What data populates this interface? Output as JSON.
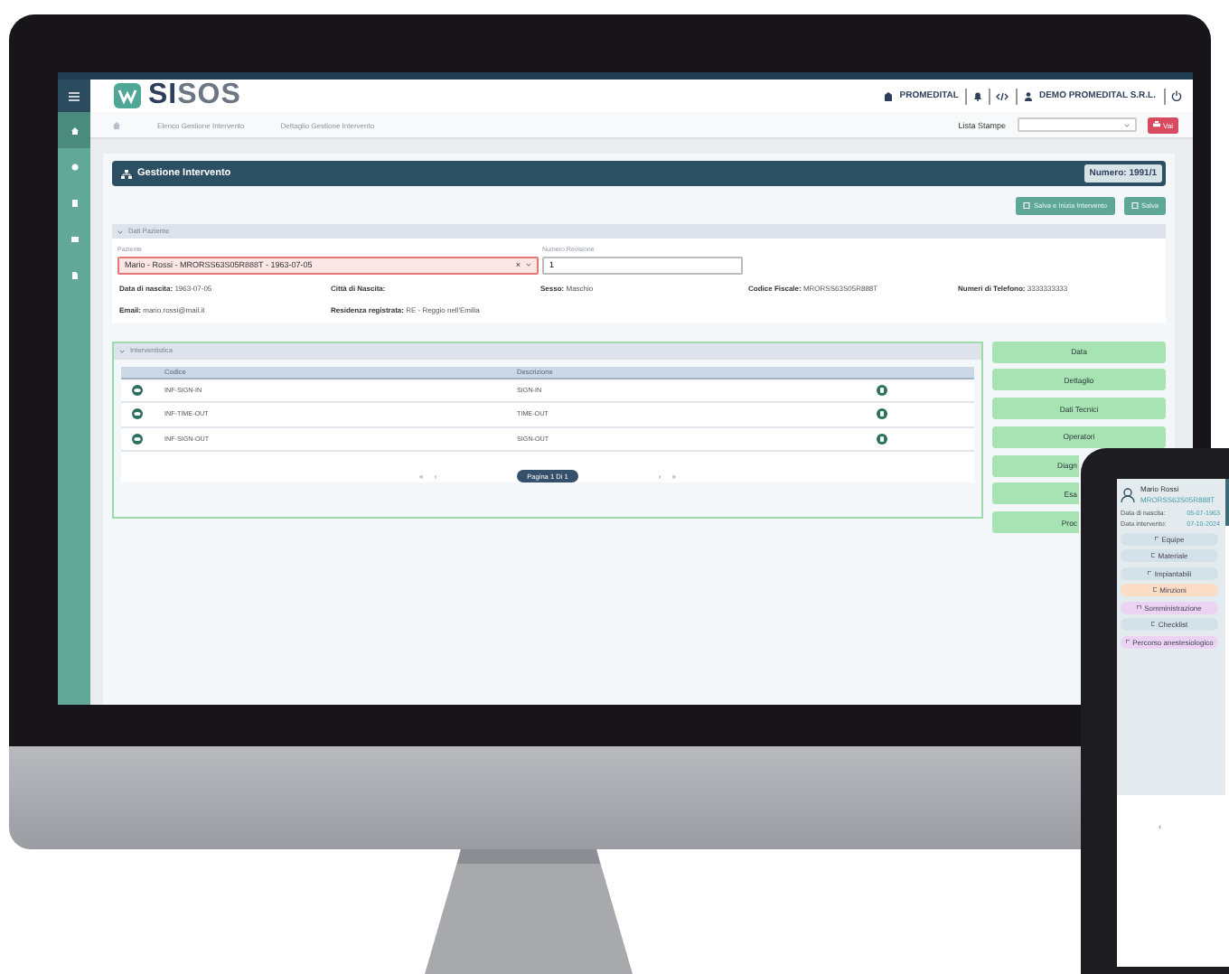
{
  "monitor": {
    "sidebar": {
      "items": [
        {
          "selected": true
        },
        {
          "selected": false
        },
        {
          "selected": false
        },
        {
          "selected": false
        },
        {
          "selected": false
        }
      ]
    },
    "logo": {
      "parts": [
        "SI",
        "SOS"
      ]
    },
    "header": {
      "organization": "PROMEDITAL",
      "company": "DEMO PROMEDITAL S.R.L."
    },
    "breadcrumb": [
      "Elenco Gestione Intervento",
      "Dettaglio Gestione Intervento"
    ],
    "print": {
      "label": "Lista Stampe",
      "button": "Vai"
    },
    "title": "Gestione Intervento",
    "number": "Numero: 1991/1",
    "actions": [
      "Salva e Inizia Intervento",
      "Salva"
    ],
    "patient_section": {
      "title": "Dati Paziente",
      "expanded": true,
      "patient_field": {
        "label": "Paziente",
        "value": "Mario - Rossi - MRORSS63S05R888T - 1963-07-05",
        "clear": "×"
      },
      "revision_field": {
        "label": "Numero Revisione",
        "value": "1"
      },
      "info": [
        {
          "label": "Data di nascita:",
          "value": "1963-07-05"
        },
        {
          "label": "Città di Nascita:"
        },
        {
          "label": "Sesso:",
          "value": "Maschio"
        },
        {
          "label": "Codice Fiscale:",
          "value": "MRORSS63S05R888T"
        },
        {
          "label": "Numeri di Telefono:",
          "value": "3333333333"
        },
        {
          "label": "Email:",
          "value": "mario.rossi@mail.it"
        },
        {
          "label": "Residenza registrata:",
          "value": "RE - Reggio nell'Emilia"
        }
      ]
    },
    "interventistica": {
      "title": "Interventistica",
      "expanded": true,
      "columns": [
        "Codice",
        "Descrizione"
      ],
      "rows": [
        {
          "code": "INF-SIGN-IN",
          "description": "SIGN-IN"
        },
        {
          "code": "INF-TIME-OUT",
          "description": "TIME-OUT"
        },
        {
          "code": "INF-SIGN-OUT",
          "description": "SIGN-OUT"
        }
      ],
      "pager": {
        "first": "«",
        "prev": "‹",
        "label": "Pagina 1 Di 1",
        "next": "›",
        "last": "»"
      }
    },
    "side_buttons": [
      {
        "label": "Data",
        "kind": "full"
      },
      {
        "label": "Dettaglio",
        "kind": "full"
      },
      {
        "label": "Dati Tecnici",
        "kind": "full"
      },
      {
        "label": "Operatori",
        "kind": "full"
      },
      {
        "label": "Diagn",
        "kind": "partial"
      },
      {
        "label": "Esa",
        "kind": "partial"
      },
      {
        "label": "Proc",
        "kind": "partial"
      }
    ]
  },
  "tablet": {
    "patient": {
      "name": "Mario Rossi",
      "code": "MRORSS63S05R888T",
      "rows": [
        {
          "label": "Data di nascita:",
          "value": "05-07-1963"
        },
        {
          "label": "Data intervento:",
          "value": "07-10-2024"
        }
      ]
    },
    "menu": [
      {
        "label": "Equipe",
        "color": "#d3e1e8"
      },
      {
        "label": "Materiale",
        "color": "#d3e1e8"
      },
      {
        "label": "Impiantabili",
        "color": "#d3e1e8"
      },
      {
        "label": "Minzioni",
        "color": "#fbdcc4"
      },
      {
        "label": "Somministrazione",
        "color": "#ecd3f3"
      },
      {
        "label": "Checklist",
        "color": "#d3e1e8"
      },
      {
        "label": "Percorso anestesiologico",
        "color": "#ecd3f3"
      }
    ],
    "pager_prev": "‹"
  }
}
